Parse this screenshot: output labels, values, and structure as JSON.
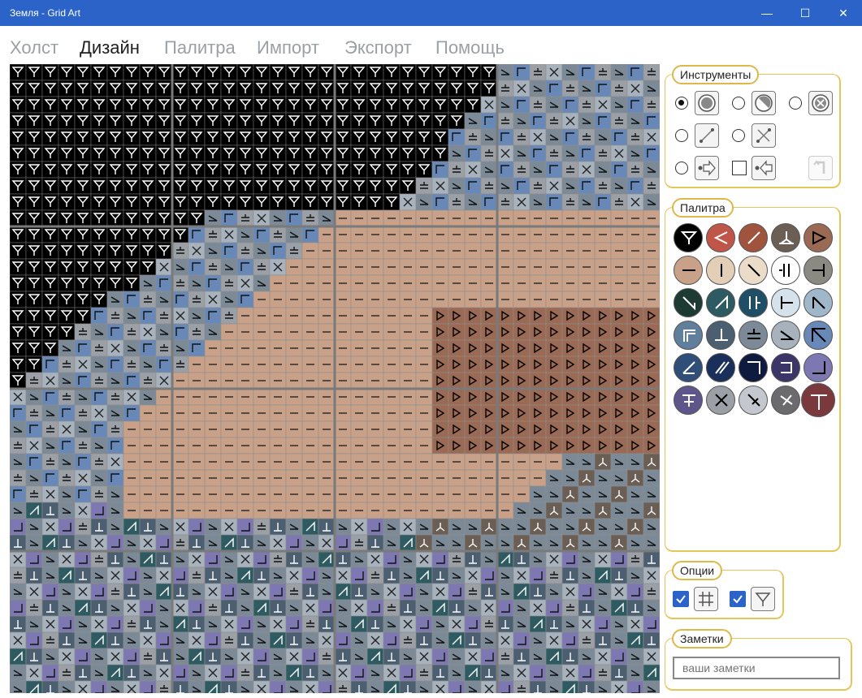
{
  "window": {
    "title": "Земля - Grid Art",
    "minimize": "—",
    "maximize": "☐",
    "close": "✕"
  },
  "menu": {
    "items": [
      "Холст",
      "Дизайн",
      "Палитра",
      "Импорт",
      "Экспорт",
      "Помощь"
    ],
    "active": 1
  },
  "tools": {
    "title": "Инструменты",
    "selected_index": 0,
    "items": [
      {
        "icon": "fill-circle-icon",
        "kind": "radio"
      },
      {
        "icon": "half-circle-icon",
        "kind": "radio"
      },
      {
        "icon": "erase-circle-icon",
        "kind": "radio"
      },
      {
        "icon": "line-icon",
        "kind": "radio"
      },
      {
        "icon": "cross-line-icon",
        "kind": "radio"
      },
      {
        "icon": "arrow-right-icon",
        "kind": "radio"
      },
      {
        "icon": "arrow-left-icon",
        "kind": "checkbox"
      },
      {
        "icon": "undo-icon",
        "kind": "disabled"
      }
    ]
  },
  "palette": {
    "title": "Палитра",
    "swatches": [
      {
        "color": "#000000",
        "symbol": "Y-fork",
        "fg": "#ffffff"
      },
      {
        "color": "#c0564a",
        "symbol": "tri-left",
        "fg": "#ffffff"
      },
      {
        "color": "#a0543e",
        "symbol": "slash",
        "fg": "#ffffff"
      },
      {
        "color": "#6b5e55",
        "symbol": "fork-down",
        "fg": "#ffffff"
      },
      {
        "color": "#9a6a55",
        "symbol": "tri-right",
        "fg": "#000000"
      },
      {
        "color": "#c9a188",
        "symbol": "dash",
        "fg": "#000000"
      },
      {
        "color": "#e3cfb8",
        "symbol": "bar",
        "fg": "#000000"
      },
      {
        "color": "#eadcc9",
        "symbol": "backslash",
        "fg": "#000000"
      },
      {
        "color": "#ffffff",
        "symbol": "bars-gap",
        "fg": "#000000"
      },
      {
        "color": "#8b8a82",
        "symbol": "tee-left",
        "fg": "#000000"
      },
      {
        "color": "#1d3b33",
        "symbol": "corner-slash",
        "fg": "#ffffff"
      },
      {
        "color": "#2e5a62",
        "symbol": "slash-corner",
        "fg": "#ffffff"
      },
      {
        "color": "#1f4f66",
        "symbol": "double-bar",
        "fg": "#ffffff"
      },
      {
        "color": "#d5e2ec",
        "symbol": "tee-right",
        "fg": "#000000"
      },
      {
        "color": "#9fb7c9",
        "symbol": "backslash-corner",
        "fg": "#000000"
      },
      {
        "color": "#5f7f9c",
        "symbol": "square-corner",
        "fg": "#ffffff"
      },
      {
        "color": "#4b5f70",
        "symbol": "up-tee",
        "fg": "#ffffff"
      },
      {
        "color": "#7b8a96",
        "symbol": "plus-minus",
        "fg": "#000000"
      },
      {
        "color": "#a7b2bd",
        "symbol": "diag-down",
        "fg": "#000000"
      },
      {
        "color": "#6889b8",
        "symbol": "corner-tl",
        "fg": "#000000"
      },
      {
        "color": "#2f4f78",
        "symbol": "angle-slash",
        "fg": "#ffffff"
      },
      {
        "color": "#1a2f5a",
        "symbol": "slash-v",
        "fg": "#ffffff"
      },
      {
        "color": "#0e1a3e",
        "symbol": "corner-tr",
        "fg": "#ffffff"
      },
      {
        "color": "#3b3568",
        "symbol": "loop-back",
        "fg": "#ffffff"
      },
      {
        "color": "#7e78b2",
        "symbol": "corner-br",
        "fg": "#000000"
      },
      {
        "color": "#5e568a",
        "symbol": "tee-strike",
        "fg": "#ffffff"
      },
      {
        "color": "#9b9fa6",
        "symbol": "x-mark",
        "fg": "#000000"
      },
      {
        "color": "#c3c8ce",
        "symbol": "slash-x",
        "fg": "#000000"
      },
      {
        "color": "#6b6b6e",
        "symbol": "slash-strike",
        "fg": "#ffffff"
      },
      {
        "color": "#7a3a3d",
        "symbol": "big-tee",
        "fg": "#ffffff"
      }
    ]
  },
  "options": {
    "title": "Опции",
    "items": [
      {
        "icon": "grid-icon",
        "checked": true
      },
      {
        "icon": "fork-filter-icon",
        "checked": true
      }
    ]
  },
  "notes": {
    "title": "Заметки",
    "placeholder": "ваши заметки"
  },
  "canvas": {
    "colors": {
      "black": "#000000",
      "tan": "#c9a188",
      "brown": "#9a6a55",
      "slate": "#7b8a96",
      "steel": "#a7b2bd",
      "blue": "#6889b8",
      "navy": "#4b5f70",
      "teal": "#2e5a62",
      "purple": "#7e78b2",
      "gray": "#9b9fa6",
      "mauve": "#6b5e55"
    }
  }
}
